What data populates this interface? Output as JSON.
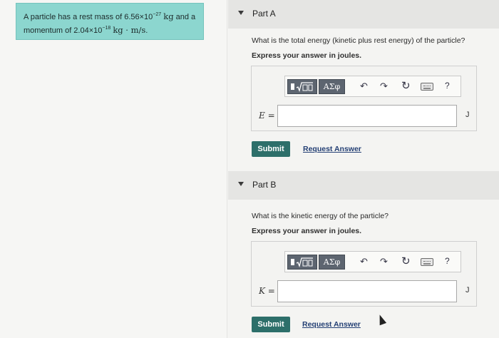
{
  "problem": {
    "line1_pre": "A particle has a rest mass of 6.56×10",
    "line1_exp": "−27",
    "line1_unit": "kg",
    "line1_post": "and a",
    "line2_pre": "momentum of 2.04×10",
    "line2_exp": "−18",
    "line2_unit": "kg · m/s",
    "line2_post": "."
  },
  "part_a": {
    "title": "Part A",
    "question": "What is the total energy (kinetic plus rest energy) of the particle?",
    "instruction": "Express your answer in joules.",
    "var_label": "E =",
    "input_value": "",
    "unit": "J",
    "submit_label": "Submit",
    "request_label": "Request Answer"
  },
  "part_b": {
    "title": "Part B",
    "question": "What is the kinetic energy of the particle?",
    "instruction": "Express your answer in joules.",
    "var_label": "K =",
    "input_value": "",
    "unit": "J",
    "submit_label": "Submit",
    "request_label": "Request Answer"
  },
  "toolbar": {
    "matrix_icon": "sqrt-template-icon",
    "greek_label": "ΑΣφ",
    "undo_glyph": "↶",
    "redo_glyph": "↷",
    "reset_glyph": "↻",
    "help_glyph": "?"
  },
  "colors": {
    "problem_bg": "#8cd6cf",
    "header_bg": "#e5e5e3",
    "submit_bg": "#2d6f6a",
    "link": "#233f74"
  }
}
